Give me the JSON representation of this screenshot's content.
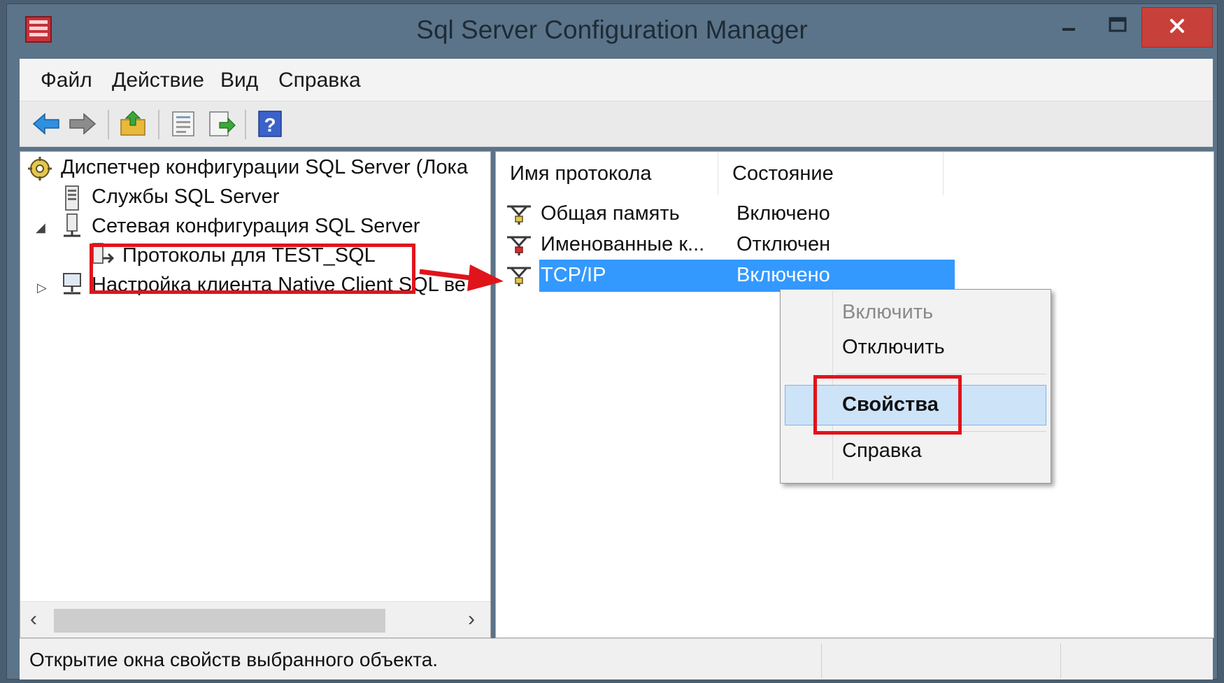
{
  "window": {
    "title": "Sql Server Configuration Manager"
  },
  "menu": {
    "file": "Файл",
    "action": "Действие",
    "view": "Вид",
    "help": "Справка"
  },
  "tree": {
    "root": "Диспетчер конфигурации SQL Server (Лока",
    "services": "Службы SQL Server",
    "network": "Сетевая конфигурация SQL Server",
    "protocols": "Протоколы для TEST_SQL",
    "client": "Настройка клиента Native Client SQL ве"
  },
  "list": {
    "col_name": "Имя протокола",
    "col_state": "Состояние",
    "rows": [
      {
        "name": "Общая память",
        "state": "Включено"
      },
      {
        "name": "Именованные к...",
        "state": "Отключен"
      },
      {
        "name": "TCP/IP",
        "state": "Включено"
      }
    ]
  },
  "context_menu": {
    "enable": "Включить",
    "disable": "Отключить",
    "properties": "Свойства",
    "help": "Справка"
  },
  "status": {
    "text": "Открытие окна свойств выбранного объекта."
  },
  "colors": {
    "selection": "#3399ff",
    "annotation": "#e0141b",
    "close_button": "#c8403a"
  }
}
